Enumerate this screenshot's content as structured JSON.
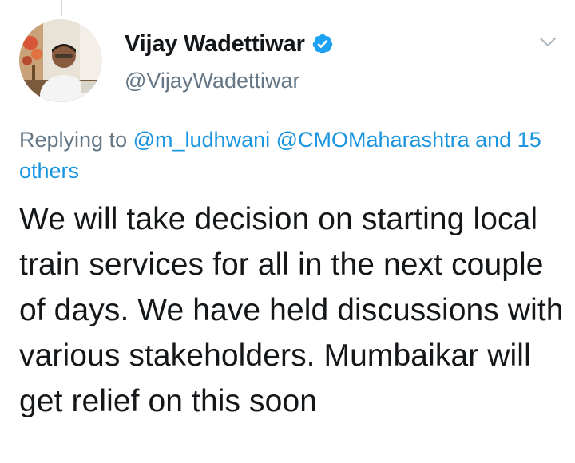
{
  "tweet": {
    "author": {
      "display_name": "Vijay Wadettiwar",
      "handle": "@VijayWadettiwar",
      "verified": true,
      "verified_icon": "verified-badge-icon"
    },
    "reply_context": {
      "prefix": "Replying to",
      "mention_1": "@m_ludhwani",
      "mention_2": "@CMOMaharashtra",
      "conjunction": "and",
      "others": "15 others"
    },
    "text": "We will take decision on starting local train services for all in the next couple of days. We have held discussions with various stakeholders. Mumbaikar will get relief on this soon",
    "menu_icon": "chevron-down-icon"
  },
  "colors": {
    "link": "#1b95e0",
    "secondary_text": "#657786",
    "primary_text": "#14171a",
    "verified": "#1da1f2"
  }
}
